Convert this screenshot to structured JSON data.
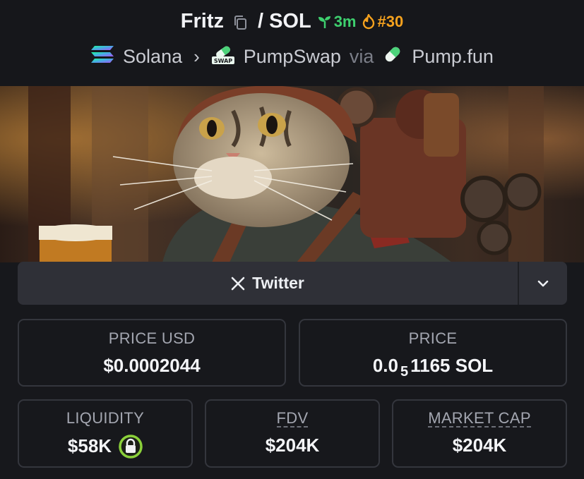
{
  "header": {
    "token_name": "Fritz",
    "separator": "/",
    "quote": "SOL",
    "age": "3m",
    "rank": "#30",
    "chain": "Solana",
    "dex": "PumpSwap",
    "dex_icon_text": "SWAP",
    "via_label": "via",
    "launchpad": "Pump.fun"
  },
  "socials": {
    "twitter_label": "Twitter"
  },
  "stats": {
    "price_usd_label": "PRICE USD",
    "price_usd_value": "$0.0002044",
    "price_label": "PRICE",
    "price_prefix": "0.0",
    "price_zeros": "5",
    "price_suffix": "1165 SOL",
    "liquidity_label": "LIQUIDITY",
    "liquidity_value": "$58K",
    "fdv_label": "FDV",
    "fdv_value": "$204K",
    "mcap_label": "MARKET CAP",
    "mcap_value": "$204K"
  },
  "colors": {
    "age_green": "#3ecf6e",
    "rank_orange": "#f6a21e",
    "lock_green": "#8bd13a"
  }
}
